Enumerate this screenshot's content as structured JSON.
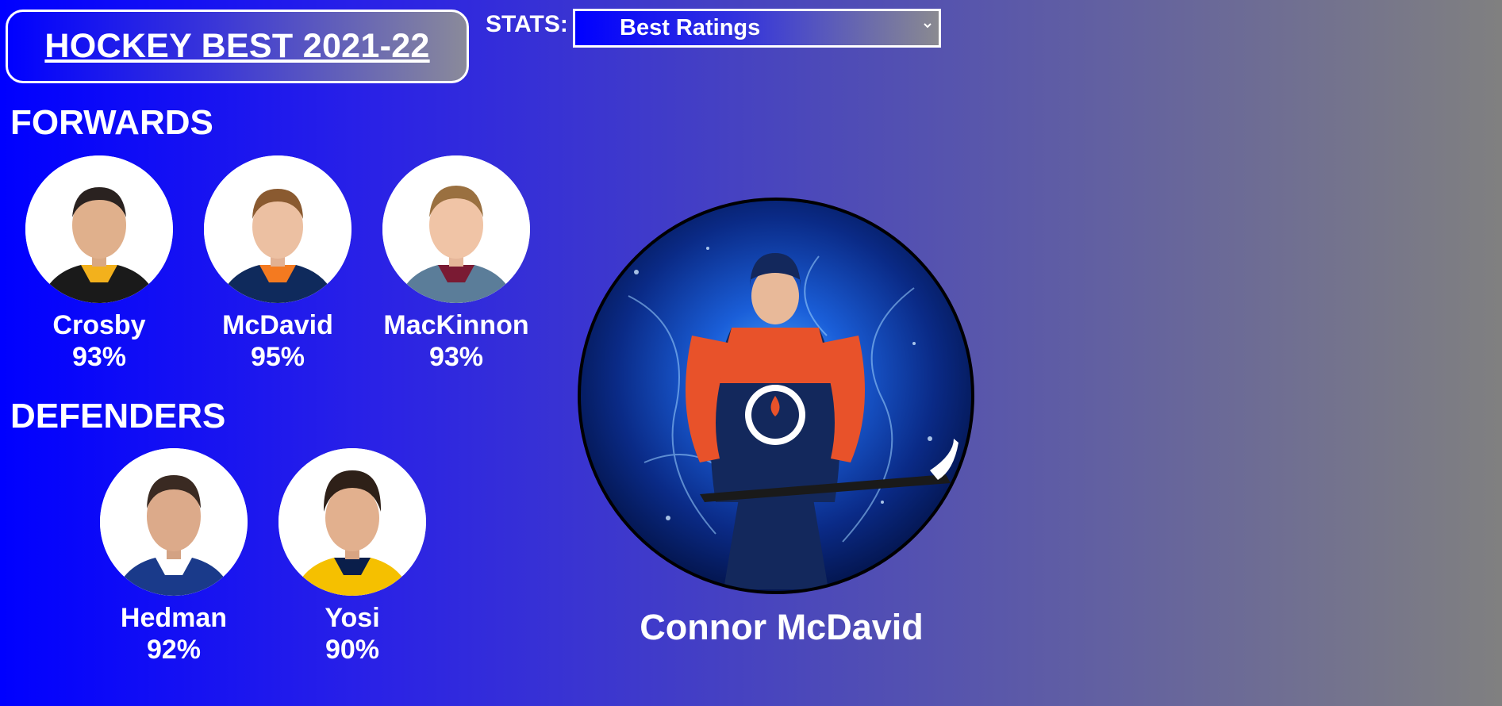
{
  "header": {
    "title": "HOCKEY BEST 2021-22"
  },
  "stats": {
    "label": "STATS:",
    "selected": "Best Ratings"
  },
  "sections": {
    "forwards": "FORWARDS",
    "defenders": "DEFENDERS"
  },
  "forwards": [
    {
      "name": "Crosby",
      "rating": "93%",
      "jersey_color": "#1a1a1a",
      "trim_color": "#f3b11c"
    },
    {
      "name": "McDavid",
      "rating": "95%",
      "jersey_color": "#0f2a5c",
      "trim_color": "#f47a20"
    },
    {
      "name": "MacKinnon",
      "rating": "93%",
      "jersey_color": "#5b7d99",
      "trim_color": "#7a1a33"
    }
  ],
  "defenders": [
    {
      "name": "Hedman",
      "rating": "92%",
      "jersey_color": "#1a3a8a",
      "trim_color": "#ffffff"
    },
    {
      "name": "Yosi",
      "rating": "90%",
      "jersey_color": "#f5c000",
      "trim_color": "#0a1e4a"
    }
  ],
  "featured": {
    "name": "Connor McDavid",
    "jersey_color": "#13285c",
    "accent_color": "#e8522a"
  },
  "icons": {
    "dropdown": "chevron-down-icon"
  }
}
